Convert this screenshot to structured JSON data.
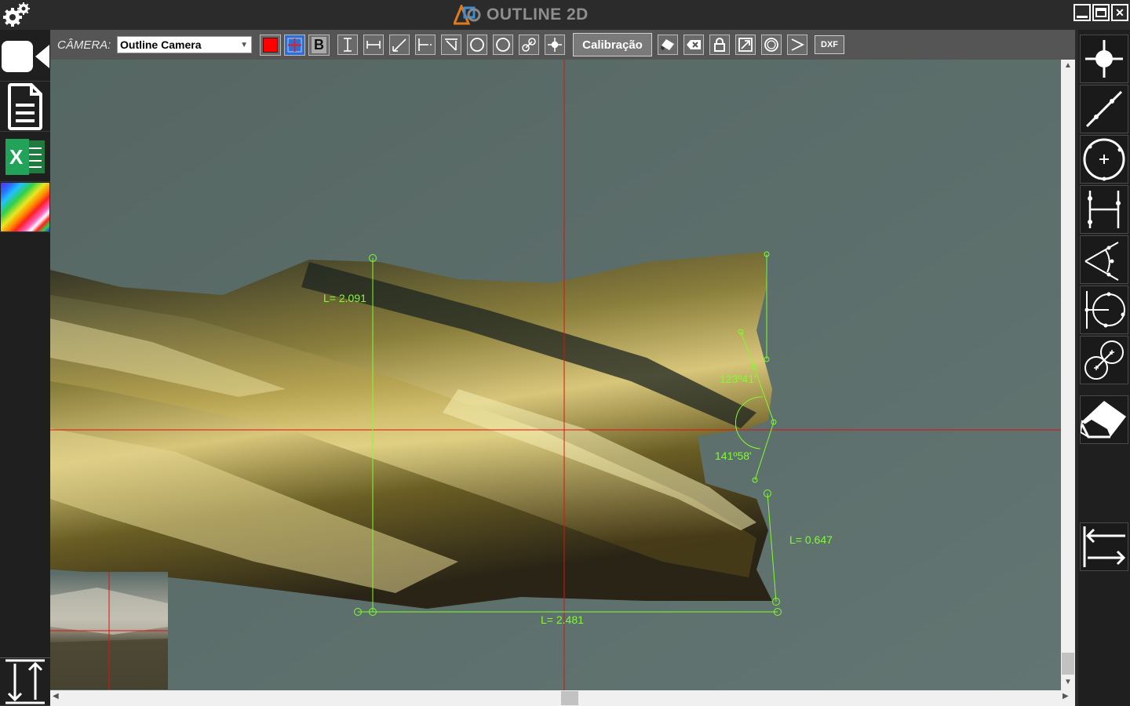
{
  "app": {
    "title": "OUTLINE 2D"
  },
  "toolbar": {
    "camera_label": "CÂMERA:",
    "camera_selected": "Outline Camera",
    "color_red": "#ff0000",
    "bold_label": "B",
    "calibration_label": "Calibração",
    "dxf_label": "DXF"
  },
  "measurements": {
    "length_left": "L= 2.091",
    "length_right": "L= 0.647",
    "length_bottom": "L= 2.481",
    "angle_top": "123º41'",
    "angle_bottom": "141º58'"
  },
  "left_sidebar": {
    "items": [
      "settings-icon",
      "video-camera-icon",
      "document-icon",
      "excel-icon",
      "color-spectrum-icon",
      "vertical-arrows-icon"
    ],
    "excel_letter": "X"
  },
  "right_sidebar": {
    "items": [
      "point-tool-icon",
      "line-tool-icon",
      "circle-tool-icon",
      "distance-tool-icon",
      "angle-tool-icon",
      "circle-center-distance-icon",
      "two-circles-distance-icon",
      "eraser-icon",
      "horizontal-arrows-icon"
    ]
  },
  "colors": {
    "crosshair": "#e01010",
    "measurement": "#7dff2a",
    "toolbar_bg": "#555555"
  }
}
